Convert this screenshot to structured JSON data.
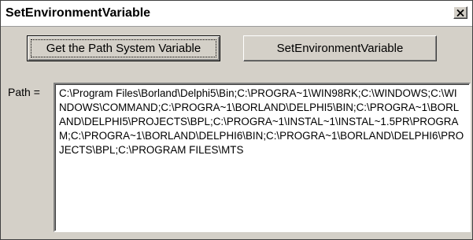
{
  "window": {
    "title": "SetEnvironmentVariable",
    "close_symbol": "✕"
  },
  "buttons": {
    "get_path_label": "Get the Path System Variable",
    "set_env_label": "SetEnvironmentVariable"
  },
  "path": {
    "label": "Path =",
    "value": "C:\\Program Files\\Borland\\Delphi5\\Bin;C:\\PROGRA~1\\WIN98RK;C:\\WINDOWS;C:\\WINDOWS\\COMMAND;C:\\PROGRA~1\\BORLAND\\DELPHI5\\BIN;C:\\PROGRA~1\\BORLAND\\DELPHI5\\PROJECTS\\BPL;C:\\PROGRA~1\\INSTAL~1\\INSTAL~1.5PR\\PROGRAM;C:\\PROGRA~1\\BORLAND\\DELPHI6\\BIN;C:\\PROGRA~1\\BORLAND\\DELPHI6\\PROJECTS\\BPL;C:\\PROGRAM FILES\\MTS"
  }
}
